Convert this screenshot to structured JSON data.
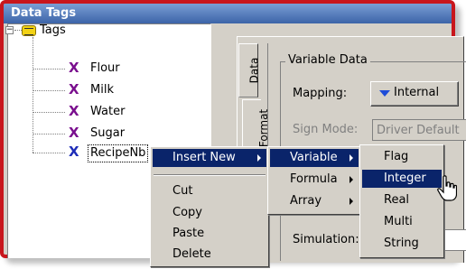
{
  "window": {
    "title": "Data Tags"
  },
  "tree": {
    "root": "Tags",
    "root_expander": "−",
    "items": [
      {
        "label": "Flour",
        "icon": "x-tag-icon",
        "color": "#7a0f8e"
      },
      {
        "label": "Milk",
        "icon": "x-tag-icon",
        "color": "#7a0f8e"
      },
      {
        "label": "Water",
        "icon": "x-tag-icon",
        "color": "#7a0f8e"
      },
      {
        "label": "Sugar",
        "icon": "x-tag-icon",
        "color": "#7a0f8e"
      },
      {
        "label": "RecipeNb",
        "icon": "x-tag-icon",
        "color": "#1e2db8"
      }
    ],
    "x_glyph": "X"
  },
  "tabs": {
    "data": "Data",
    "format": "Format"
  },
  "variable_data": {
    "group_title": "Variable Data",
    "mapping_label": "Mapping:",
    "mapping_value": "Internal",
    "sign_mode_label": "Sign Mode:",
    "sign_mode_value": "Driver Default",
    "simulation_label": "Simulation:"
  },
  "context_menu": {
    "items": [
      "Insert New",
      "Cut",
      "Copy",
      "Paste",
      "Delete"
    ]
  },
  "submenu": {
    "items": [
      "Variable",
      "Formula",
      "Array"
    ]
  },
  "type_menu": {
    "items": [
      "Flag",
      "Integer",
      "Real",
      "Multi",
      "String"
    ],
    "highlighted": "Integer"
  },
  "colors": {
    "accent_frame": "#c8161c",
    "highlight": "#0a246a",
    "mapping_arrow": "#1e4cd8"
  }
}
